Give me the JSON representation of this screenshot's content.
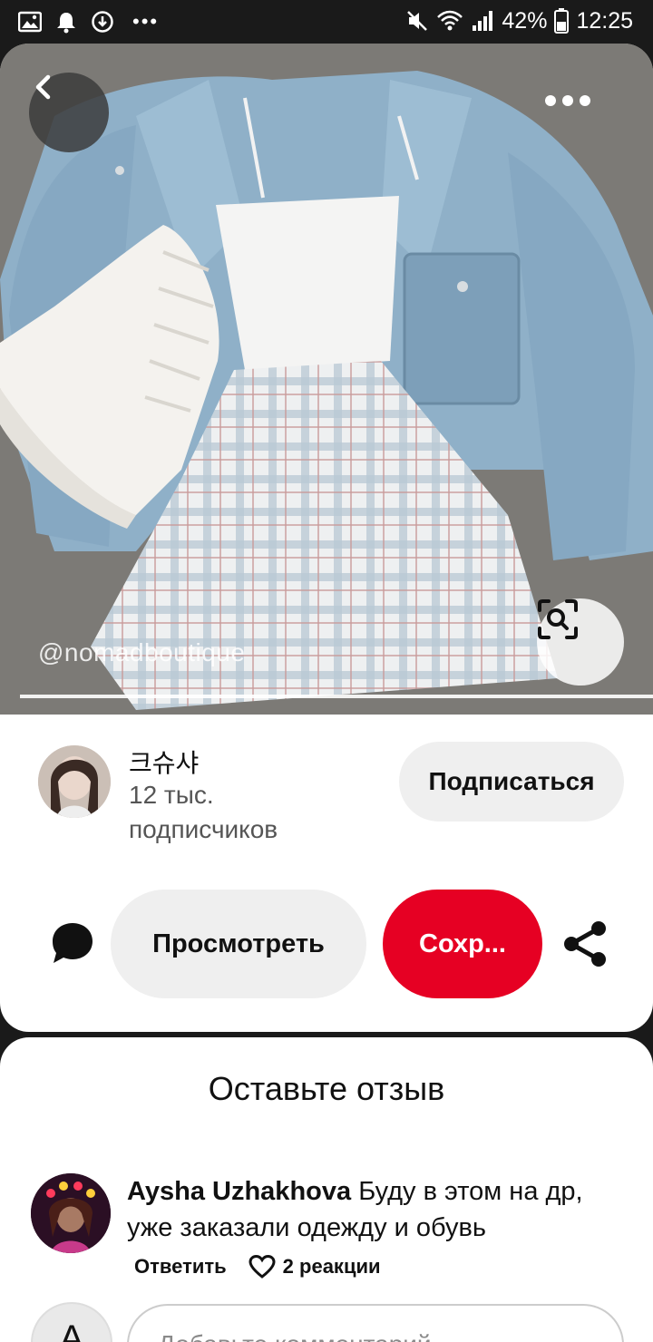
{
  "status_bar": {
    "overflow_dots": "•••",
    "battery": "42%",
    "time": "12:25",
    "icons": [
      "image-icon",
      "alarm-icon",
      "data-saver-icon",
      "mute-icon",
      "wifi-icon",
      "signal-icon",
      "battery-icon"
    ]
  },
  "pin": {
    "watermark": "@nomadboutique"
  },
  "creator": {
    "name": "크슈샤",
    "subscribers": "12 тыс. подписчиков",
    "follow_label": "Подписаться"
  },
  "actions": {
    "view_label": "Просмотреть",
    "save_label": "Сохр..."
  },
  "comments": {
    "title": "Оставьте отзыв",
    "items": [
      {
        "author": "Aysha Uzhakhova",
        "text": "Буду в этом на др, уже заказали одежду и обувь",
        "reply_label": "Ответить",
        "reactions": "2 реакции"
      }
    ],
    "my_avatar_letter": "A",
    "input_placeholder": "Добавьте комментарий"
  },
  "colors": {
    "brand_red": "#e60023",
    "button_gray": "#efefef",
    "text": "#111111"
  }
}
